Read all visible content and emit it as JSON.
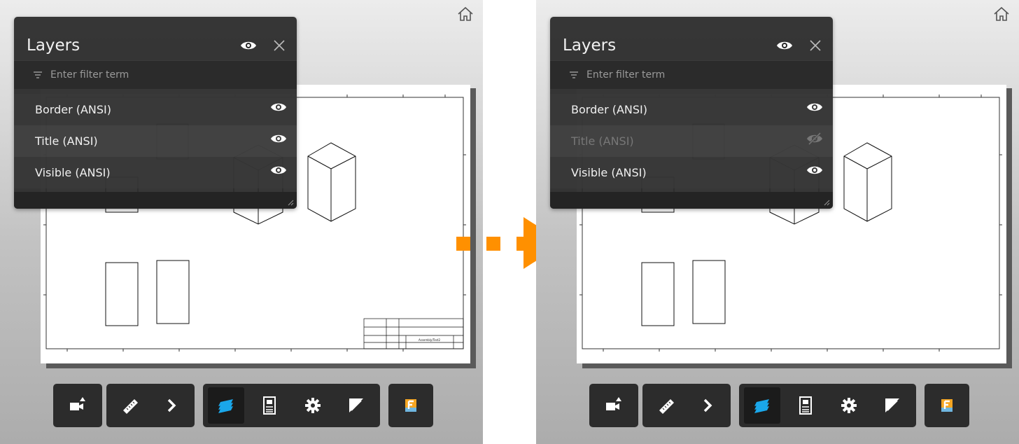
{
  "colors": {
    "panel_bg": "#2a2a2a",
    "accent_blue": "#1aa7ea",
    "transition_arrow": "#ff9000",
    "hidden_text": "#777777"
  },
  "before": {
    "panel": {
      "title": "Layers",
      "filter_placeholder": "Enter filter term",
      "layers": [
        {
          "label": "Border (ANSI)",
          "visible": true
        },
        {
          "label": "Title (ANSI)",
          "visible": true
        },
        {
          "label": "Visible (ANSI)",
          "visible": true
        }
      ]
    },
    "title_block_text": "Assembly/Test2"
  },
  "after": {
    "panel": {
      "title": "Layers",
      "filter_placeholder": "Enter filter term",
      "layers": [
        {
          "label": "Border (ANSI)",
          "visible": true
        },
        {
          "label": "Title (ANSI)",
          "visible": false
        },
        {
          "label": "Visible (ANSI)",
          "visible": true
        }
      ]
    }
  },
  "toolbar": {
    "buttons": [
      "camera-icon",
      "measure-icon",
      "expand-arrow-icon",
      "layers-icon",
      "properties-icon",
      "settings-gear-icon",
      "fullscreen-icon",
      "fusion-icon"
    ],
    "active": "layers-icon"
  },
  "transition": "orange-arrow-icon"
}
